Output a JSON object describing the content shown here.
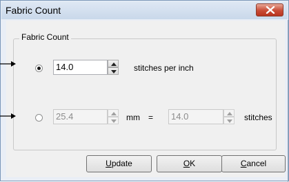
{
  "window": {
    "title": "Fabric Count"
  },
  "group": {
    "label": "Fabric Count"
  },
  "row1": {
    "selected": true,
    "value": "14.0",
    "unit_label": "stitches per inch"
  },
  "row2": {
    "selected": false,
    "mm_value": "25.4",
    "mm_label": "mm",
    "equals": "=",
    "stitches_value": "14.0",
    "stitches_label": "stitches"
  },
  "buttons": {
    "update": {
      "mnemonic": "U",
      "rest": "pdate"
    },
    "ok": {
      "mnemonic": "O",
      "rest": "K"
    },
    "cancel": {
      "mnemonic": "C",
      "rest": "ancel"
    }
  }
}
